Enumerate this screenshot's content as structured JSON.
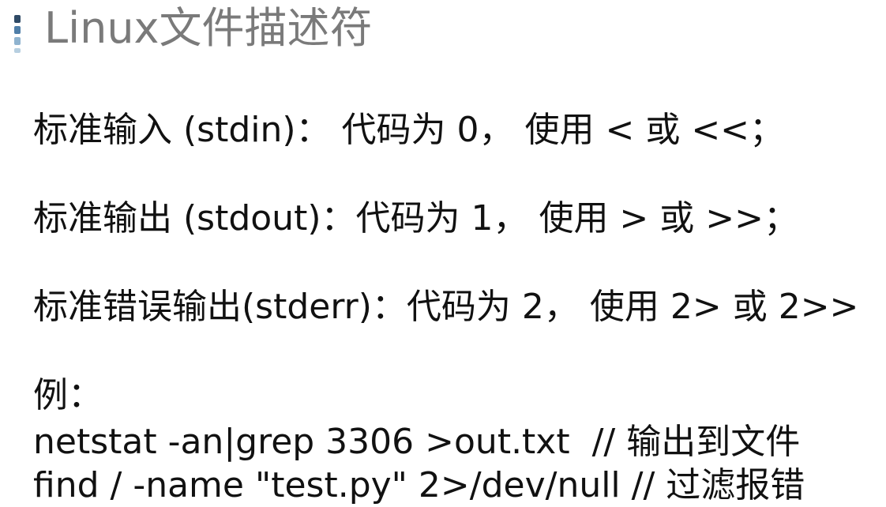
{
  "slide": {
    "title": "Linux文件描述符"
  },
  "content": {
    "stdin_line": "标准输入 (stdin)： 代码为 0， 使用 < 或 <<；",
    "stdout_line": "标准输出 (stdout)：代码为 1， 使用 > 或 >>；",
    "stderr_line": "标准错误输出(stderr)：代码为 2， 使用 2> 或 2>>",
    "example_label": "例：",
    "example_commands": [
      "netstat -an|grep 3306 >out.txt  // 输出到文件",
      "find / -name \"test.py\" 2>/dev/null // 过滤报错"
    ]
  },
  "colors": {
    "title": "#7a7a7a",
    "text": "#111111",
    "accent_dark": "#2f4a66",
    "accent_mid": "#4f7ea8",
    "accent_light": "#8fb3cf"
  }
}
